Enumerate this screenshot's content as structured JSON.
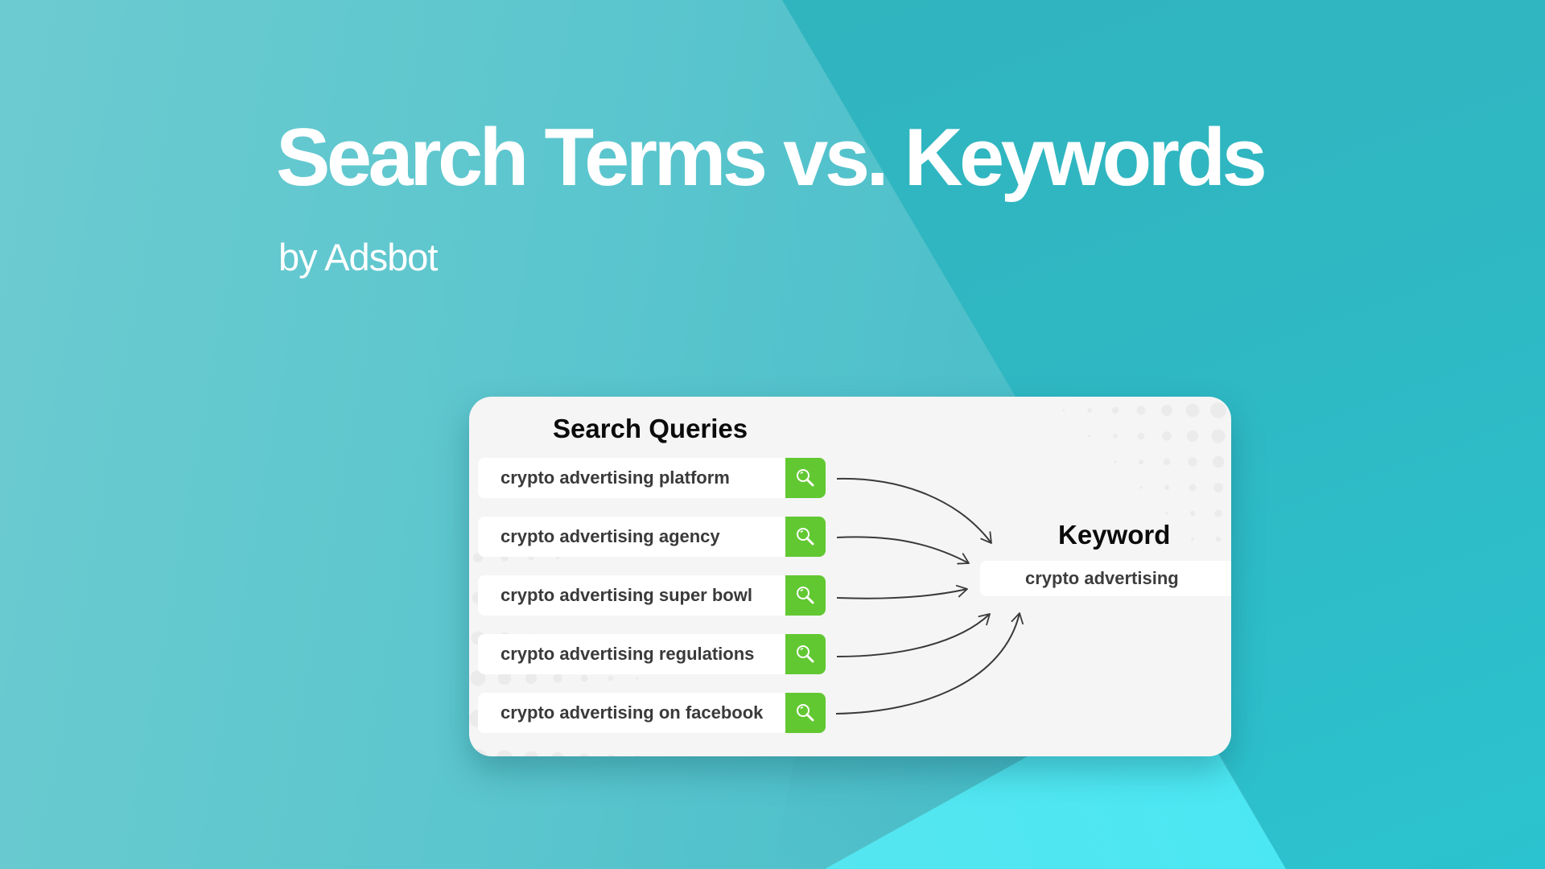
{
  "header": {
    "title": "Search Terms vs. Keywords",
    "subtitle": "by Adsbot"
  },
  "diagram": {
    "queries_title": "Search Queries",
    "queries": [
      {
        "label": "crypto advertising platform",
        "icon": "search-icon"
      },
      {
        "label": "crypto advertising agency",
        "icon": "search-icon"
      },
      {
        "label": "crypto advertising super bowl",
        "icon": "search-icon"
      },
      {
        "label": "crypto advertising regulations",
        "icon": "search-icon"
      },
      {
        "label": "crypto advertising on facebook",
        "icon": "search-icon"
      }
    ],
    "keyword_title": "Keyword",
    "keyword": "crypto advertising"
  },
  "colors": {
    "search_button": "#62c832",
    "card_background": "#f5f5f5",
    "background_teal": "#2bc3cf",
    "accent_cyan": "#3ee8f4"
  }
}
